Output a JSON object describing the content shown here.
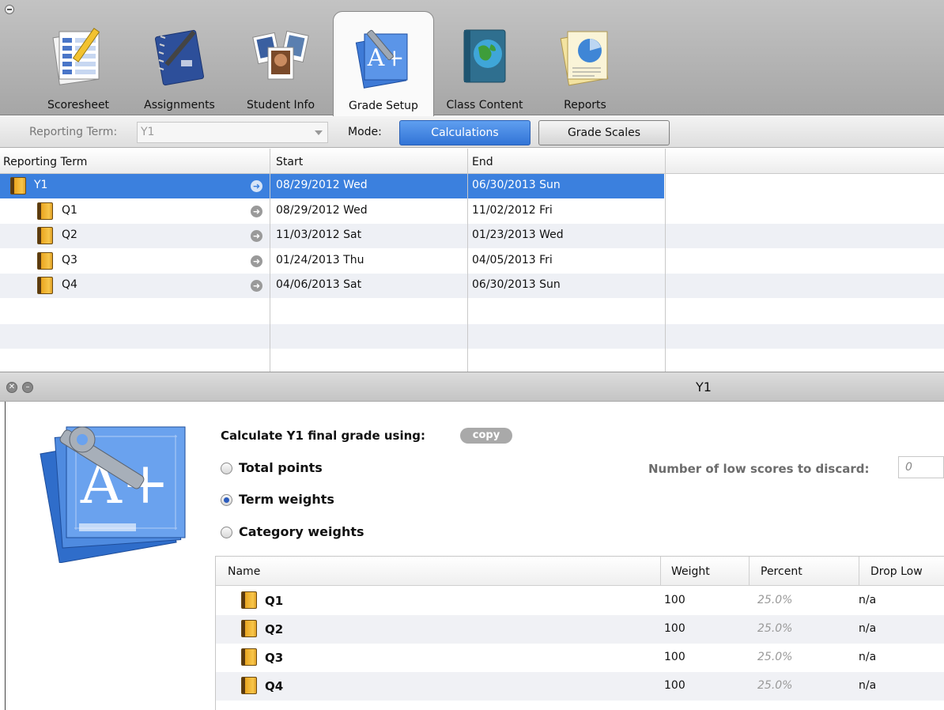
{
  "toolbar": {
    "tabs": [
      {
        "label": "Scoresheet",
        "icon": "scoresheet-icon"
      },
      {
        "label": "Assignments",
        "icon": "notebook-icon"
      },
      {
        "label": "Student Info",
        "icon": "student-photos-icon"
      },
      {
        "label": "Grade Setup",
        "icon": "grade-setup-icon",
        "active": true
      },
      {
        "label": "Class Content",
        "icon": "globe-book-icon"
      },
      {
        "label": "Reports",
        "icon": "report-pie-icon"
      }
    ]
  },
  "filter": {
    "reporting_term_label": "Reporting Term:",
    "reporting_term_value": "Y1",
    "mode_label": "Mode:",
    "mode_options": [
      "Calculations",
      "Grade Scales"
    ],
    "selected_mode": "Calculations"
  },
  "terms_table": {
    "columns": [
      "Reporting Term",
      "Start",
      "End"
    ],
    "rows": [
      {
        "name": "Y1",
        "start": "08/29/2012 Wed",
        "end": "06/30/2013 Sun",
        "selected": true
      },
      {
        "name": "Q1",
        "start": "08/29/2012 Wed",
        "end": "11/02/2012 Fri"
      },
      {
        "name": "Q2",
        "start": "11/03/2012 Sat",
        "end": "01/23/2013 Wed"
      },
      {
        "name": "Q3",
        "start": "01/24/2013 Thu",
        "end": "04/05/2013 Fri"
      },
      {
        "name": "Q4",
        "start": "04/06/2013 Sat",
        "end": "06/30/2013 Sun"
      }
    ]
  },
  "detail": {
    "title": "Y1",
    "calc_label": "Calculate Y1 final grade using:",
    "copy_label": "copy",
    "options": [
      "Total points",
      "Term weights",
      "Category weights"
    ],
    "selected_option": "Term weights",
    "discard_label": "Number of low scores to discard:",
    "discard_value": "0",
    "weights_table": {
      "columns": [
        "Name",
        "Weight",
        "Percent",
        "Drop Low"
      ],
      "rows": [
        {
          "name": "Q1",
          "weight": "100",
          "percent": "25.0%",
          "drop_low": "n/a"
        },
        {
          "name": "Q2",
          "weight": "100",
          "percent": "25.0%",
          "drop_low": "n/a"
        },
        {
          "name": "Q3",
          "weight": "100",
          "percent": "25.0%",
          "drop_low": "n/a"
        },
        {
          "name": "Q4",
          "weight": "100",
          "percent": "25.0%",
          "drop_low": "n/a"
        }
      ]
    }
  },
  "colors": {
    "selection": "#3b80de",
    "toolbar": "#b3b3b3",
    "book": "#e9a520"
  }
}
